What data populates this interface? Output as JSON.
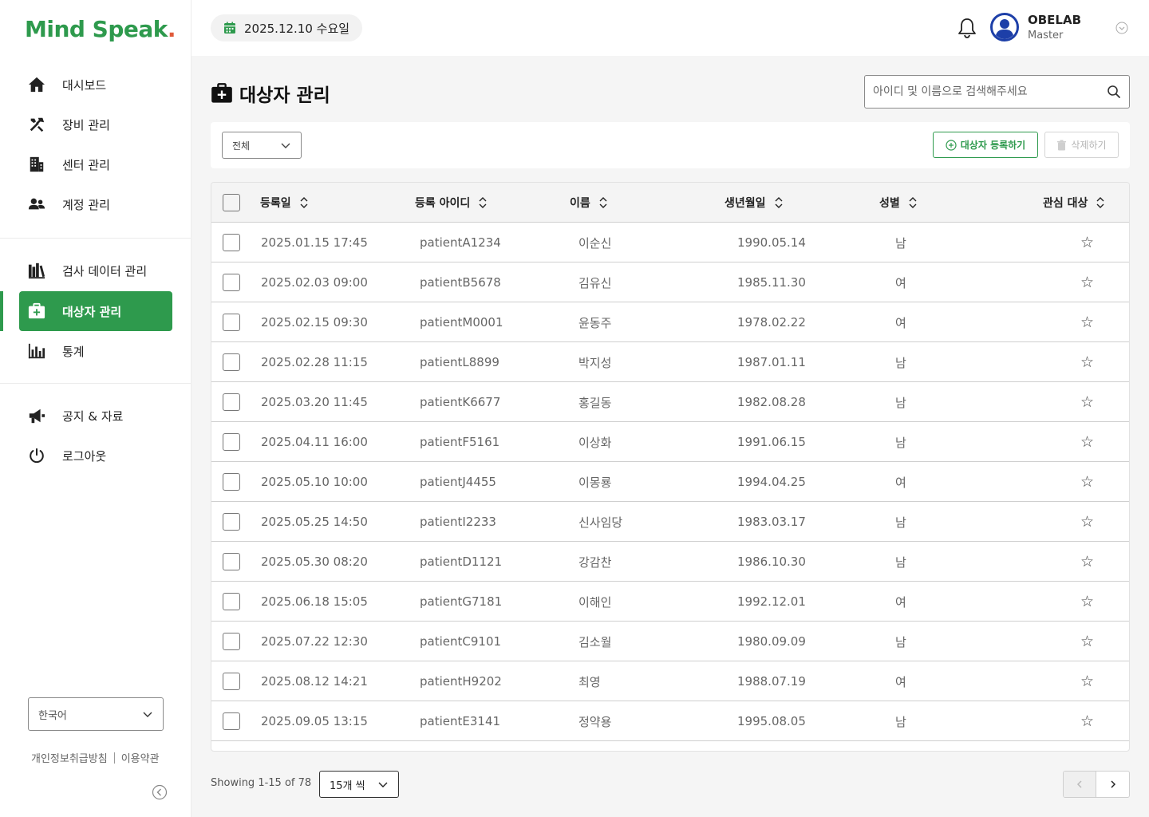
{
  "app": {
    "logo_text": "Mind Speak",
    "logo_dot": "."
  },
  "sidebar": {
    "items": [
      {
        "label": "대시보드",
        "icon": "home-icon"
      },
      {
        "label": "장비 관리",
        "icon": "tools-icon"
      },
      {
        "label": "센터 관리",
        "icon": "building-icon"
      },
      {
        "label": "계정 관리",
        "icon": "users-icon"
      },
      {
        "label": "검사 데이터 관리",
        "icon": "books-icon"
      },
      {
        "label": "대상자 관리",
        "icon": "first-aid-icon",
        "active": true
      },
      {
        "label": "통계",
        "icon": "bar-chart-icon"
      },
      {
        "label": "공지 & 자료",
        "icon": "megaphone-icon"
      },
      {
        "label": "로그아웃",
        "icon": "power-icon"
      }
    ],
    "language": "한국어",
    "footer_privacy": "개인정보취급방침",
    "footer_terms": "이용약관"
  },
  "topbar": {
    "date": "2025.12.10 수요일",
    "user_name": "OBELAB",
    "user_role": "Master"
  },
  "page": {
    "title": "대상자 관리",
    "search_placeholder": "아이디 및 이름으로 검색해주세요"
  },
  "filter": {
    "selected": "전체",
    "register_label": "대상자 등록하기",
    "delete_label": "삭제하기"
  },
  "table": {
    "columns": [
      "등록일",
      "등록 아이디",
      "이름",
      "생년월일",
      "성별",
      "관심 대상"
    ],
    "rows": [
      {
        "date": "2025.01.15 17:45",
        "id": "patientA1234",
        "name": "이순신",
        "birth": "1990.05.14",
        "gender": "남",
        "star": "☆"
      },
      {
        "date": "2025.02.03 09:00",
        "id": "patientB5678",
        "name": "김유신",
        "birth": "1985.11.30",
        "gender": "여",
        "star": "☆"
      },
      {
        "date": "2025.02.15 09:30",
        "id": "patientM0001",
        "name": "윤동주",
        "birth": "1978.02.22",
        "gender": "여",
        "star": "☆"
      },
      {
        "date": "2025.02.28 11:15",
        "id": "patientL8899",
        "name": "박지성",
        "birth": "1987.01.11",
        "gender": "남",
        "star": "☆"
      },
      {
        "date": "2025.03.20 11:45",
        "id": "patientK6677",
        "name": "홍길동",
        "birth": "1982.08.28",
        "gender": "남",
        "star": "☆"
      },
      {
        "date": "2025.04.11 16:00",
        "id": "patientF5161",
        "name": "이상화",
        "birth": "1991.06.15",
        "gender": "남",
        "star": "☆"
      },
      {
        "date": "2025.05.10 10:00",
        "id": "patientJ4455",
        "name": "이몽룡",
        "birth": "1994.04.25",
        "gender": "여",
        "star": "☆"
      },
      {
        "date": "2025.05.25 14:50",
        "id": "patientI2233",
        "name": "신사임당",
        "birth": "1983.03.17",
        "gender": "남",
        "star": "☆"
      },
      {
        "date": "2025.05.30 08:20",
        "id": "patientD1121",
        "name": "강감찬",
        "birth": "1986.10.30",
        "gender": "남",
        "star": "☆"
      },
      {
        "date": "2025.06.18 15:05",
        "id": "patientG7181",
        "name": "이해인",
        "birth": "1992.12.01",
        "gender": "여",
        "star": "☆"
      },
      {
        "date": "2025.07.22 12:30",
        "id": "patientC9101",
        "name": "김소월",
        "birth": "1980.09.09",
        "gender": "남",
        "star": "☆"
      },
      {
        "date": "2025.08.12 14:21",
        "id": "patientH9202",
        "name": "최영",
        "birth": "1988.07.19",
        "gender": "여",
        "star": "☆"
      },
      {
        "date": "2025.09.05 13:15",
        "id": "patientE3141",
        "name": "정약용",
        "birth": "1995.08.05",
        "gender": "남",
        "star": "☆"
      }
    ]
  },
  "pagination": {
    "showing": "Showing 1-15 of 78",
    "per_page": "15개 씩"
  },
  "colors": {
    "brand": "#2e9a4d",
    "logo_dot": "#e05a3a",
    "avatar": "#1d3fa8"
  }
}
